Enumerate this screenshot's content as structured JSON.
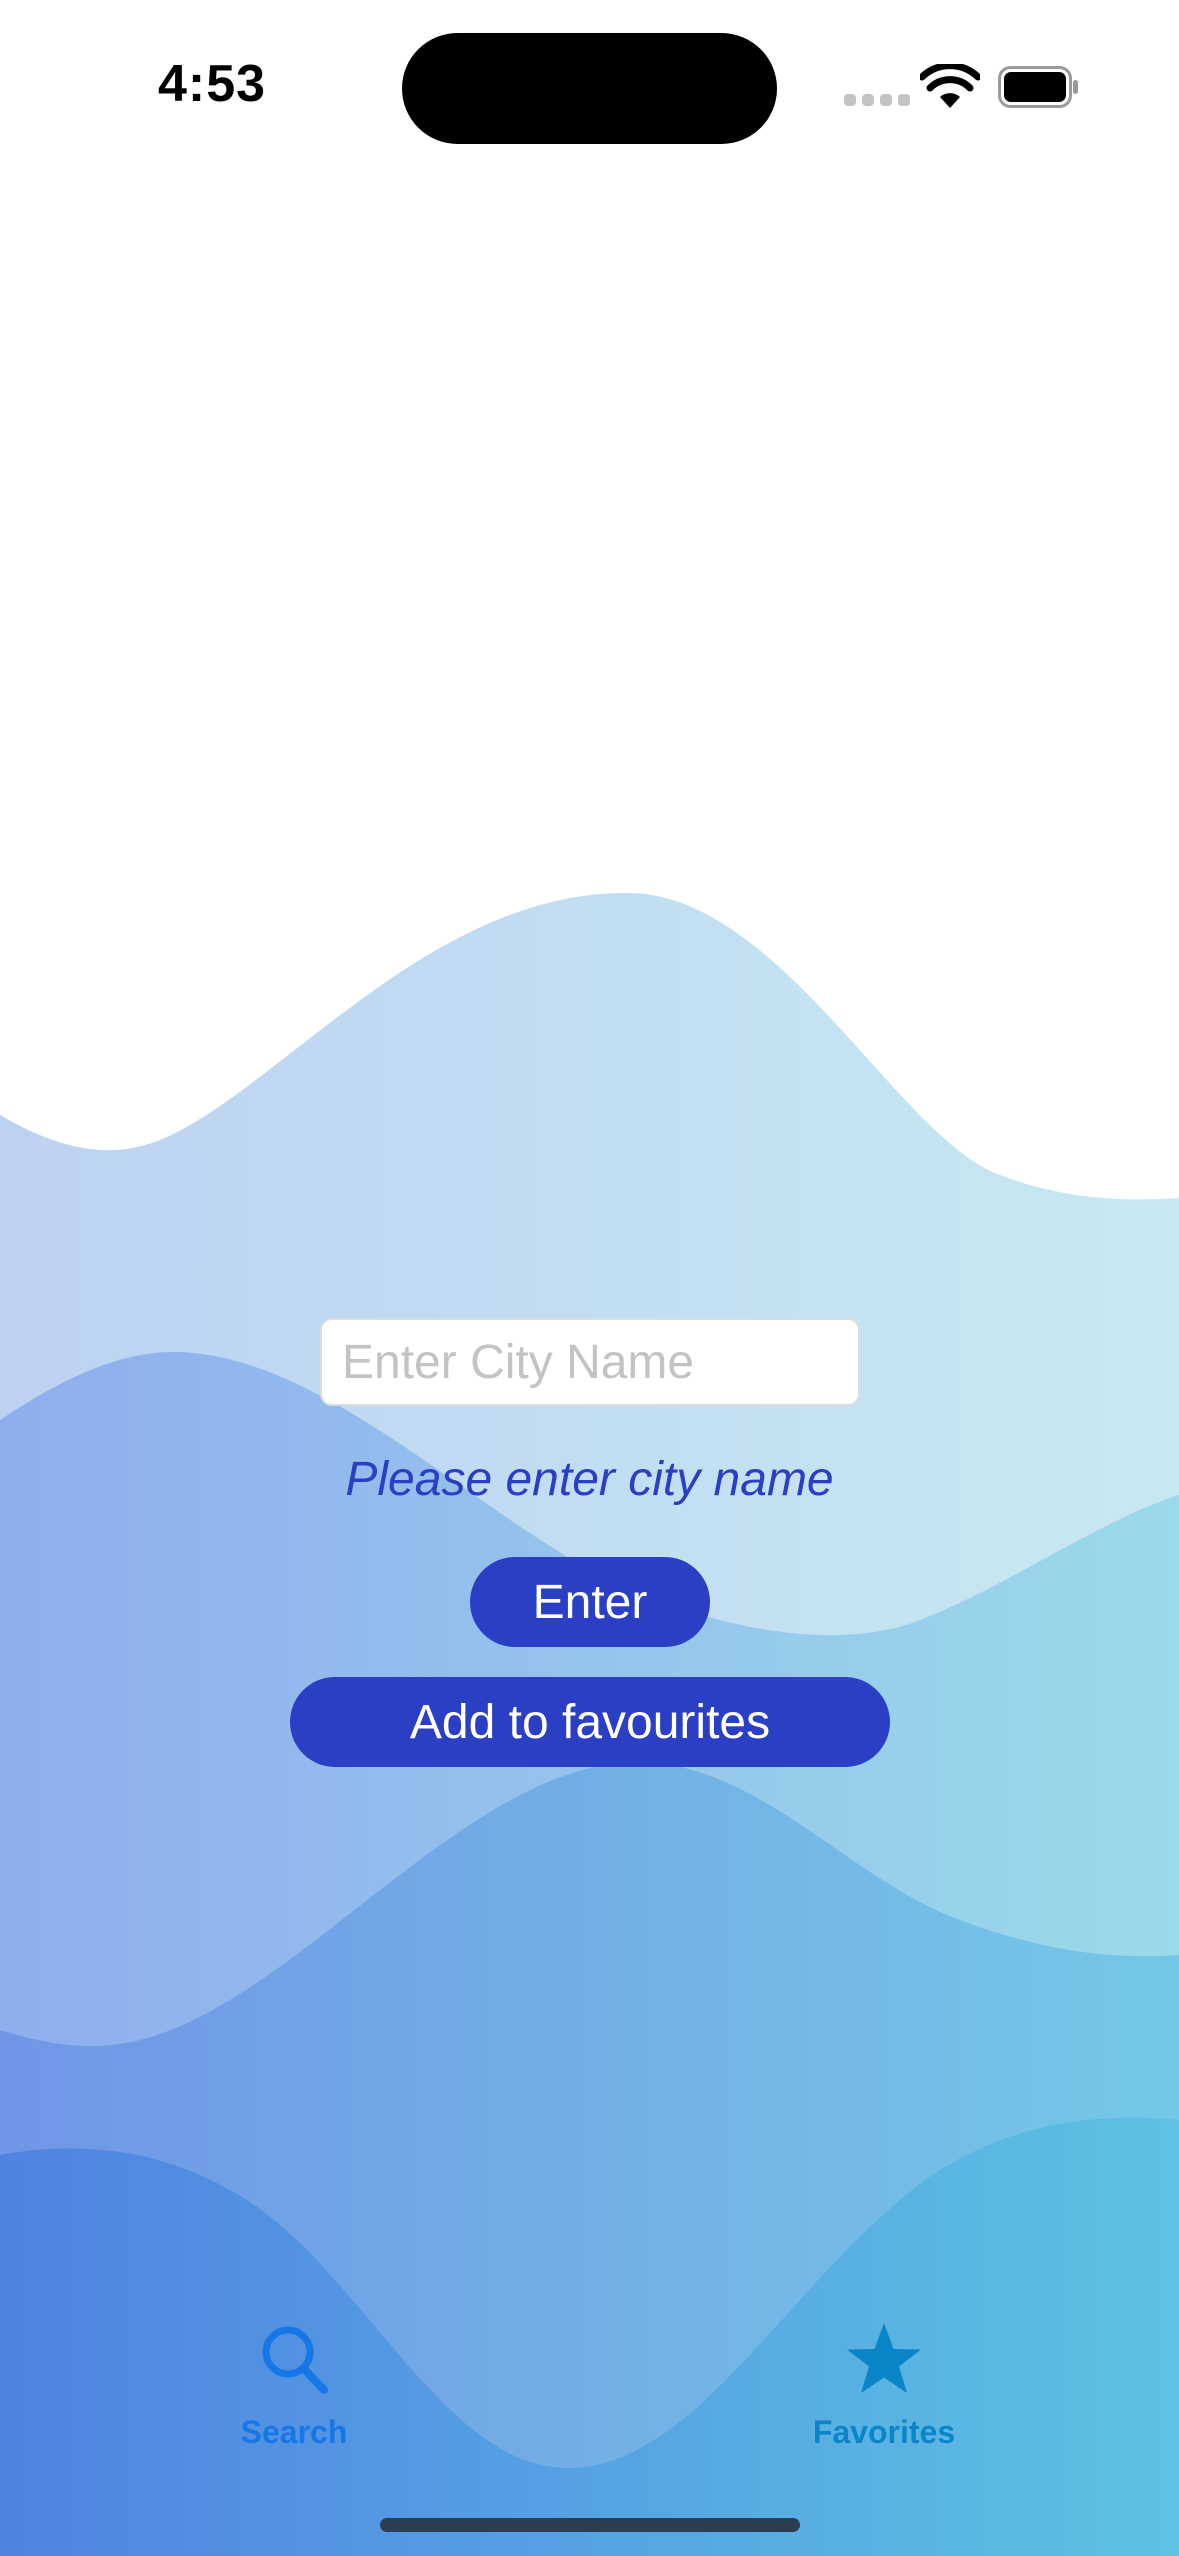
{
  "status_bar": {
    "time": "4:53"
  },
  "form": {
    "city_input": {
      "placeholder": "Enter City Name",
      "value": ""
    },
    "hint": "Please enter city name",
    "enter_label": "Enter",
    "favourites_label": "Add to favourites"
  },
  "tab_bar": {
    "items": [
      {
        "label": "Search",
        "icon": "magnifying-glass-icon",
        "selected": true
      },
      {
        "label": "Favorites",
        "icon": "star-icon",
        "selected": false
      }
    ]
  },
  "colors": {
    "accent": "#2a3fc4",
    "tab_search": "#1777e6",
    "tab_favorites": "#0a86c8"
  }
}
